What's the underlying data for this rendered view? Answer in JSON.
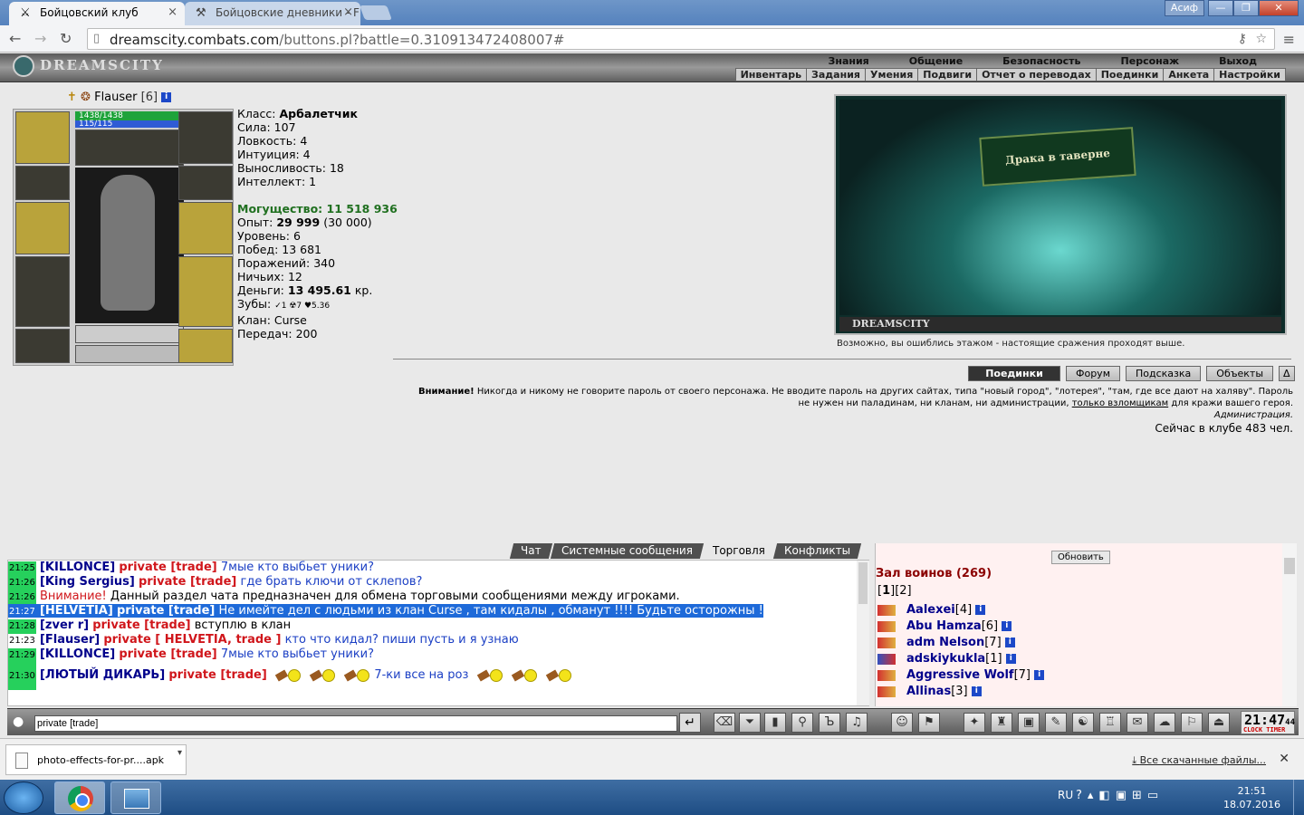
{
  "browser": {
    "tabs": [
      {
        "label": "Бойцовский клуб",
        "icon": "crossed-swords-icon",
        "active": true
      },
      {
        "label": "Бойцовские дневники - F",
        "icon": "sword-icon",
        "active": false
      }
    ],
    "window_buttons": [
      "—",
      "❐",
      "✕"
    ],
    "user_badge": "Асиф",
    "url_prefix": "dreamscity.combats.com",
    "url_suffix": "/buttons.pl?battle=0.310913472408007#"
  },
  "game": {
    "logo": "DREAMSCITY",
    "main_menu": [
      "Знания",
      "Общение",
      "Безопасность",
      "Персонаж",
      "Выход"
    ],
    "sub_menu": [
      "Инвентарь",
      "Задания",
      "Умения",
      "Подвиги",
      "Отчет о переводах",
      "Поединки",
      "Анкета",
      "Настройки"
    ],
    "character": {
      "name": "Flauser",
      "level": "[6]",
      "hp": "1438/1438",
      "mana": "115/115",
      "stats": {
        "class_label": "Класс:",
        "class_value": "Арбалетчик",
        "strength": "Сила: 107",
        "agility": "Ловкость: 4",
        "intuition": "Интуиция: 4",
        "endurance": "Выносливость: 18",
        "intellect": "Интеллект: 1",
        "power_label": "Могущество:",
        "power_value": "11 518 936",
        "exp_label": "Опыт:",
        "exp_value": "29 999",
        "exp_next": "(30 000)",
        "level_line": "Уровень: 6",
        "wins": "Побед: 13 681",
        "losses": "Поражений: 340",
        "draws": "Ничьих: 12",
        "money_label": "Деньги:",
        "money_value": "13 495.61",
        "money_unit": "кр.",
        "teeth_label": "Зубы:",
        "teeth_value": "✓1 ☢7 ♥5.36",
        "clan": "Клан: Curse",
        "transfers": "Передач: 200"
      }
    },
    "location": {
      "banner": "Драка в таверне",
      "footer": "DREAMSCITY",
      "note": "Возможно, вы ошиблись этажом - настоящие сражения проходят выше."
    },
    "buttons": [
      "Поединки",
      "Форум",
      "Подсказка",
      "Объекты",
      "Δ"
    ],
    "warning": {
      "lead": "Внимание!",
      "text1": " Никогда и никому не говорите пароль от своего персонажа. Не вводите пароль на других сайтах, типа \"новый город\", \"лотерея\", \"там, где все дают на халяву\". Пароль не нужен ни паладинам, ни кланам, ни администрации, ",
      "link": "только взломщикам",
      "text2": " для кражи вашего героя.",
      "sign": "Администрация."
    },
    "online": "Сейчас в клубе 483 чел."
  },
  "chat": {
    "tabs": [
      "Чат",
      "Системные сообщения",
      "Торговля",
      "Конфликты"
    ],
    "selected_tab": "Торговля",
    "lines": [
      {
        "time": "21:25",
        "nick": "[KILLONCE]",
        "tag": "private [trade]",
        "msg": "7мые кто выбьет уники?"
      },
      {
        "time": "21:26",
        "nick": "[King Sergius]",
        "tag": "private [trade]",
        "msg": "где брать ключи от склепов?"
      },
      {
        "time": "21:26",
        "nick": "",
        "tag": "Внимание!",
        "msg": "Данный раздел чата предназначен для обмена торговыми сообщениями между игроками."
      },
      {
        "time": "21:27",
        "nick": "[HELVETIA]",
        "tag": "private [trade]",
        "msg": "Не имейте дел с людьми из клан Curse , там кидалы , обманут !!!! Будьте осторожны !"
      },
      {
        "time": "21:28",
        "nick": "[zver r]",
        "tag": "private [trade]",
        "msg": "вступлю в клан"
      },
      {
        "time": "21:23",
        "nick": "[Flauser]",
        "tag": "private [ HELVETIA, trade ]",
        "msg": "кто что кидал? пиши пусть и я узнаю"
      },
      {
        "time": "21:29",
        "nick": "[KILLONCE]",
        "tag": "private [trade]",
        "msg": "7мые кто выбьет уники?"
      },
      {
        "time": "21:30",
        "nick": "[ЛЮТЫЙ ДИКАРЬ]",
        "tag": "private [trade]",
        "msg": "7-ки все на роз"
      }
    ],
    "input_value": "private [trade]"
  },
  "hall": {
    "refresh": "Обновить",
    "title": "Зал воинов (269)",
    "pages_current": "1",
    "pages_next": "[2]",
    "players": [
      {
        "name": "Aalexei",
        "level": "[4]"
      },
      {
        "name": "Abu Hamza",
        "level": "[6]"
      },
      {
        "name": "adm Nelson",
        "level": "[7]"
      },
      {
        "name": "adskiykukla",
        "level": "[1]"
      },
      {
        "name": "Aggressive Wolf",
        "level": "[7]"
      },
      {
        "name": "Allinas",
        "level": "[3]"
      }
    ]
  },
  "clock": {
    "time": "21:47",
    "sec": "44",
    "sub": "CLOCK TIMER"
  },
  "downloads": {
    "file": "photo-effects-for-pr....apk",
    "all": "Все скачанные файлы..."
  },
  "taskbar": {
    "lang": "RU",
    "time": "21:51",
    "date": "18.07.2016"
  }
}
